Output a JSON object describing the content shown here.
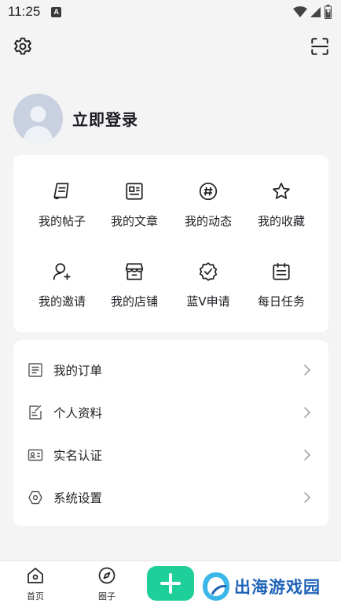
{
  "status_bar": {
    "time": "11:25",
    "notification_badge": "A"
  },
  "profile": {
    "login_label": "立即登录"
  },
  "quick_grid": [
    {
      "label": "我的帖子",
      "icon": "post-icon"
    },
    {
      "label": "我的文章",
      "icon": "article-icon"
    },
    {
      "label": "我的动态",
      "icon": "hashtag-icon"
    },
    {
      "label": "我的收藏",
      "icon": "star-icon"
    },
    {
      "label": "我的邀请",
      "icon": "invite-user-icon"
    },
    {
      "label": "我的店铺",
      "icon": "store-icon"
    },
    {
      "label": "蓝V申请",
      "icon": "verified-badge-icon"
    },
    {
      "label": "每日任务",
      "icon": "calendar-icon"
    }
  ],
  "menu": [
    {
      "label": "我的订单",
      "icon": "order-list-icon"
    },
    {
      "label": "个人资料",
      "icon": "edit-profile-icon"
    },
    {
      "label": "实名认证",
      "icon": "id-card-icon"
    },
    {
      "label": "系统设置",
      "icon": "hexagon-settings-icon"
    }
  ],
  "tabbar": {
    "home_label": "首页",
    "circle_label": "圈子"
  },
  "watermark": {
    "text": "出海游戏园"
  },
  "colors": {
    "accent": "#1fcf9a",
    "background": "#f4f4f5",
    "card": "#ffffff",
    "watermark": "#1e63b8"
  }
}
